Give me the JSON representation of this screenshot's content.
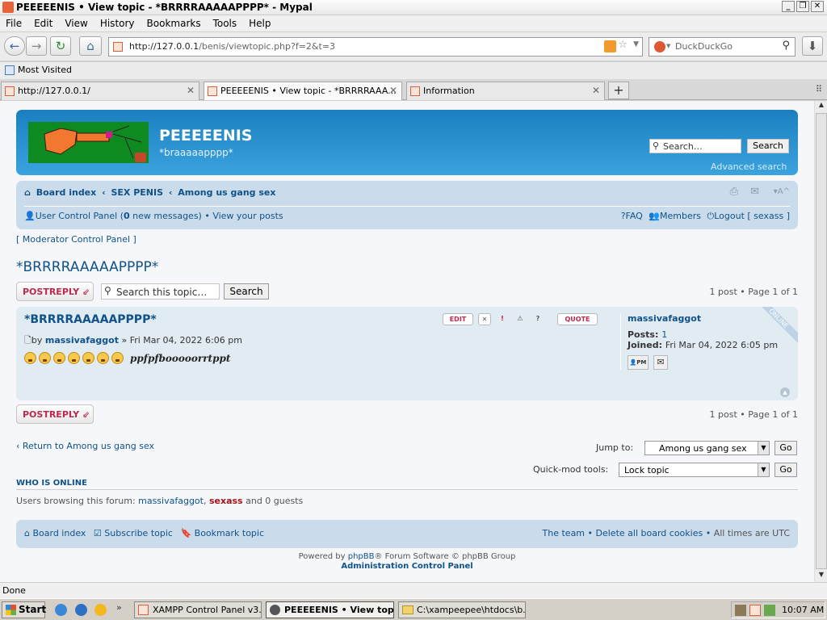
{
  "window": {
    "title": "PEEEEENIS • View topic - *BRRRRAAAAAPPPP* - Mypal"
  },
  "menu": [
    "File",
    "Edit",
    "View",
    "History",
    "Bookmarks",
    "Tools",
    "Help"
  ],
  "nav": {
    "url_host": "http://127.0.0.1",
    "url_path": "/benis/viewtopic.php?f=2&t=3",
    "search_engine": "DuckDuckGo"
  },
  "bookmarks": {
    "most_visited": "Most Visited"
  },
  "tabs": [
    {
      "label": "http://127.0.0.1/"
    },
    {
      "label": "PEEEEENIS • View topic - *BRRRRAAA..."
    },
    {
      "label": "Information"
    }
  ],
  "site": {
    "name": "PEEEEENIS",
    "desc": "*braaaaapppp*",
    "search_placeholder": "Search…",
    "search_btn": "Search",
    "advanced": "Advanced search"
  },
  "breadcrumb": [
    "Board index",
    "SEX PENIS",
    "Among us gang sex"
  ],
  "ucp": {
    "user_cp": "User Control Panel (",
    "count": "0",
    "suffix": " new messages)",
    "sep": " • ",
    "your_posts": "View your posts"
  },
  "navright": {
    "faq": "FAQ",
    "members": "Members",
    "logout": "Logout [ sexass ]"
  },
  "modcp": "[ Moderator Control Panel ]",
  "topic": {
    "title": "*BRRRRAAAAAPPPP*",
    "postreply": "POSTREPLY",
    "search_placeholder": "Search this topic…",
    "search_btn": "Search",
    "pagination": "1 post • Page 1 of 1"
  },
  "post": {
    "subject": "*BRRRRAAAAAPPPP*",
    "edit": "EDIT",
    "quote": "QUOTE",
    "by": "by ",
    "author": "massivafaggot",
    "date": " » Fri Mar 04, 2022 6:06 pm",
    "text": "ppfpfbooooorrtppt",
    "online": "ONLINE"
  },
  "profile": {
    "username": "massivafaggot",
    "posts_label": "Posts: ",
    "posts": "1",
    "joined_label": "Joined: ",
    "joined": "Fri Mar 04, 2022 6:05 pm",
    "pm": "PM"
  },
  "bottom": {
    "return": "‹ Return to Among us gang sex",
    "jump_label": "Jump to:",
    "jump_value": "Among us gang sex",
    "go": "Go",
    "quickmod_label": "Quick-mod tools:",
    "quickmod_value": "Lock topic"
  },
  "who": {
    "heading": "WHO IS ONLINE",
    "prefix": "Users browsing this forum: ",
    "user1": "massivafaggot",
    "sep": ", ",
    "user2": "sexass",
    "suffix": " and 0 guests"
  },
  "footer": {
    "board_index": "Board index",
    "subscribe": "Subscribe topic",
    "bookmark": "Bookmark topic",
    "team": "The team",
    "delete_cookies": "Delete all board cookies",
    "times": "All times are UTC",
    "sep": " • "
  },
  "copyright": {
    "powered_prefix": "Powered by ",
    "phpbb": "phpBB",
    "powered_suffix": "® Forum Software © phpBB Group",
    "acp": "Administration Control Panel"
  },
  "status": "Done",
  "taskbar": {
    "start": "Start",
    "items": [
      "XAMPP Control Panel v3....",
      "PEEEEENIS • View top...",
      "C:\\xampeepee\\htdocs\\b..."
    ],
    "clock": "10:07 AM"
  },
  "colors": {
    "header_blue": "#1b7fbf",
    "nav_panel": "#cadceb",
    "post_bg": "#e1ebf2",
    "link": "#105289",
    "postreply_red": "#bc2a4d"
  }
}
